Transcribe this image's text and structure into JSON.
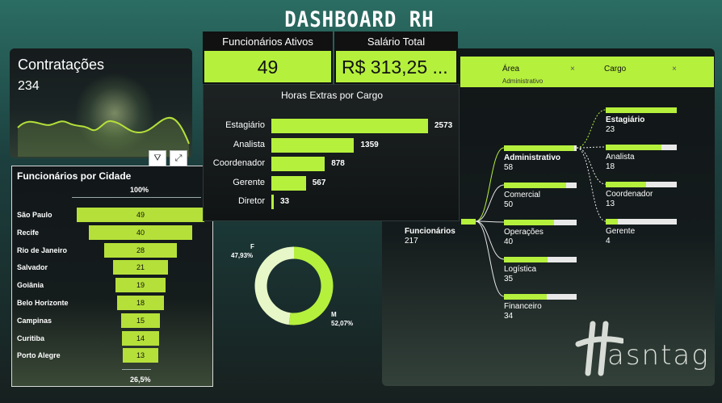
{
  "title": "Dashboard RH",
  "contratacoes": {
    "label": "Contratações",
    "value": "234"
  },
  "cidades": {
    "title": "Funcionários por Cidade",
    "top_pct": "100%",
    "bottom_pct": "26,5%",
    "items": [
      {
        "name": "São Paulo",
        "value": 49
      },
      {
        "name": "Recife",
        "value": 40
      },
      {
        "name": "Rio de Janeiro",
        "value": 28
      },
      {
        "name": "Salvador",
        "value": 21
      },
      {
        "name": "Goiânia",
        "value": 19
      },
      {
        "name": "Belo Horizonte",
        "value": 18
      },
      {
        "name": "Campinas",
        "value": 15
      },
      {
        "name": "Curitiba",
        "value": 14
      },
      {
        "name": "Porto Alegre",
        "value": 13
      }
    ]
  },
  "kpis": {
    "ativos_label": "Funcionários Ativos",
    "ativos_value": "49",
    "salario_label": "Salário Total",
    "salario_value": "R$ 313,25 ..."
  },
  "horas": {
    "title": "Horas Extras por Cargo",
    "items": [
      {
        "cargo": "Estagiário",
        "value": 2573
      },
      {
        "cargo": "Analista",
        "value": 1359
      },
      {
        "cargo": "Coordenador",
        "value": 878
      },
      {
        "cargo": "Gerente",
        "value": 567
      },
      {
        "cargo": "Diretor",
        "value": 33
      }
    ]
  },
  "genero": {
    "f_label": "F",
    "f_pct": "47,93%",
    "m_label": "M",
    "m_pct": "52,07%",
    "f_value": 47.93,
    "m_value": 52.07,
    "f_color": "#e8f7c8",
    "m_color": "#b5f03d"
  },
  "tree": {
    "chip_area_label": "Área",
    "chip_area_value": "Administrativo",
    "chip_cargo_label": "Cargo",
    "chip_close": "×",
    "root_label": "Funcionários",
    "root_value": "217",
    "areas": [
      {
        "name": "Administrativo",
        "value": "58",
        "fill": 0.97
      },
      {
        "name": "Comercial",
        "value": "50",
        "fill": 0.86
      },
      {
        "name": "Operações",
        "value": "40",
        "fill": 0.69
      },
      {
        "name": "Logística",
        "value": "35",
        "fill": 0.6
      },
      {
        "name": "Financeiro",
        "value": "34",
        "fill": 0.59
      }
    ],
    "cargos": [
      {
        "name": "Estagiário",
        "value": "23",
        "fill": 1.0
      },
      {
        "name": "Analista",
        "value": "18",
        "fill": 0.78
      },
      {
        "name": "Coordenador",
        "value": "13",
        "fill": 0.57
      },
      {
        "name": "Gerente",
        "value": "4",
        "fill": 0.17
      }
    ]
  },
  "logo": "Hasntag",
  "tool_icons": [
    "filter-icon",
    "focus-mode-icon",
    "more-options-icon"
  ]
}
